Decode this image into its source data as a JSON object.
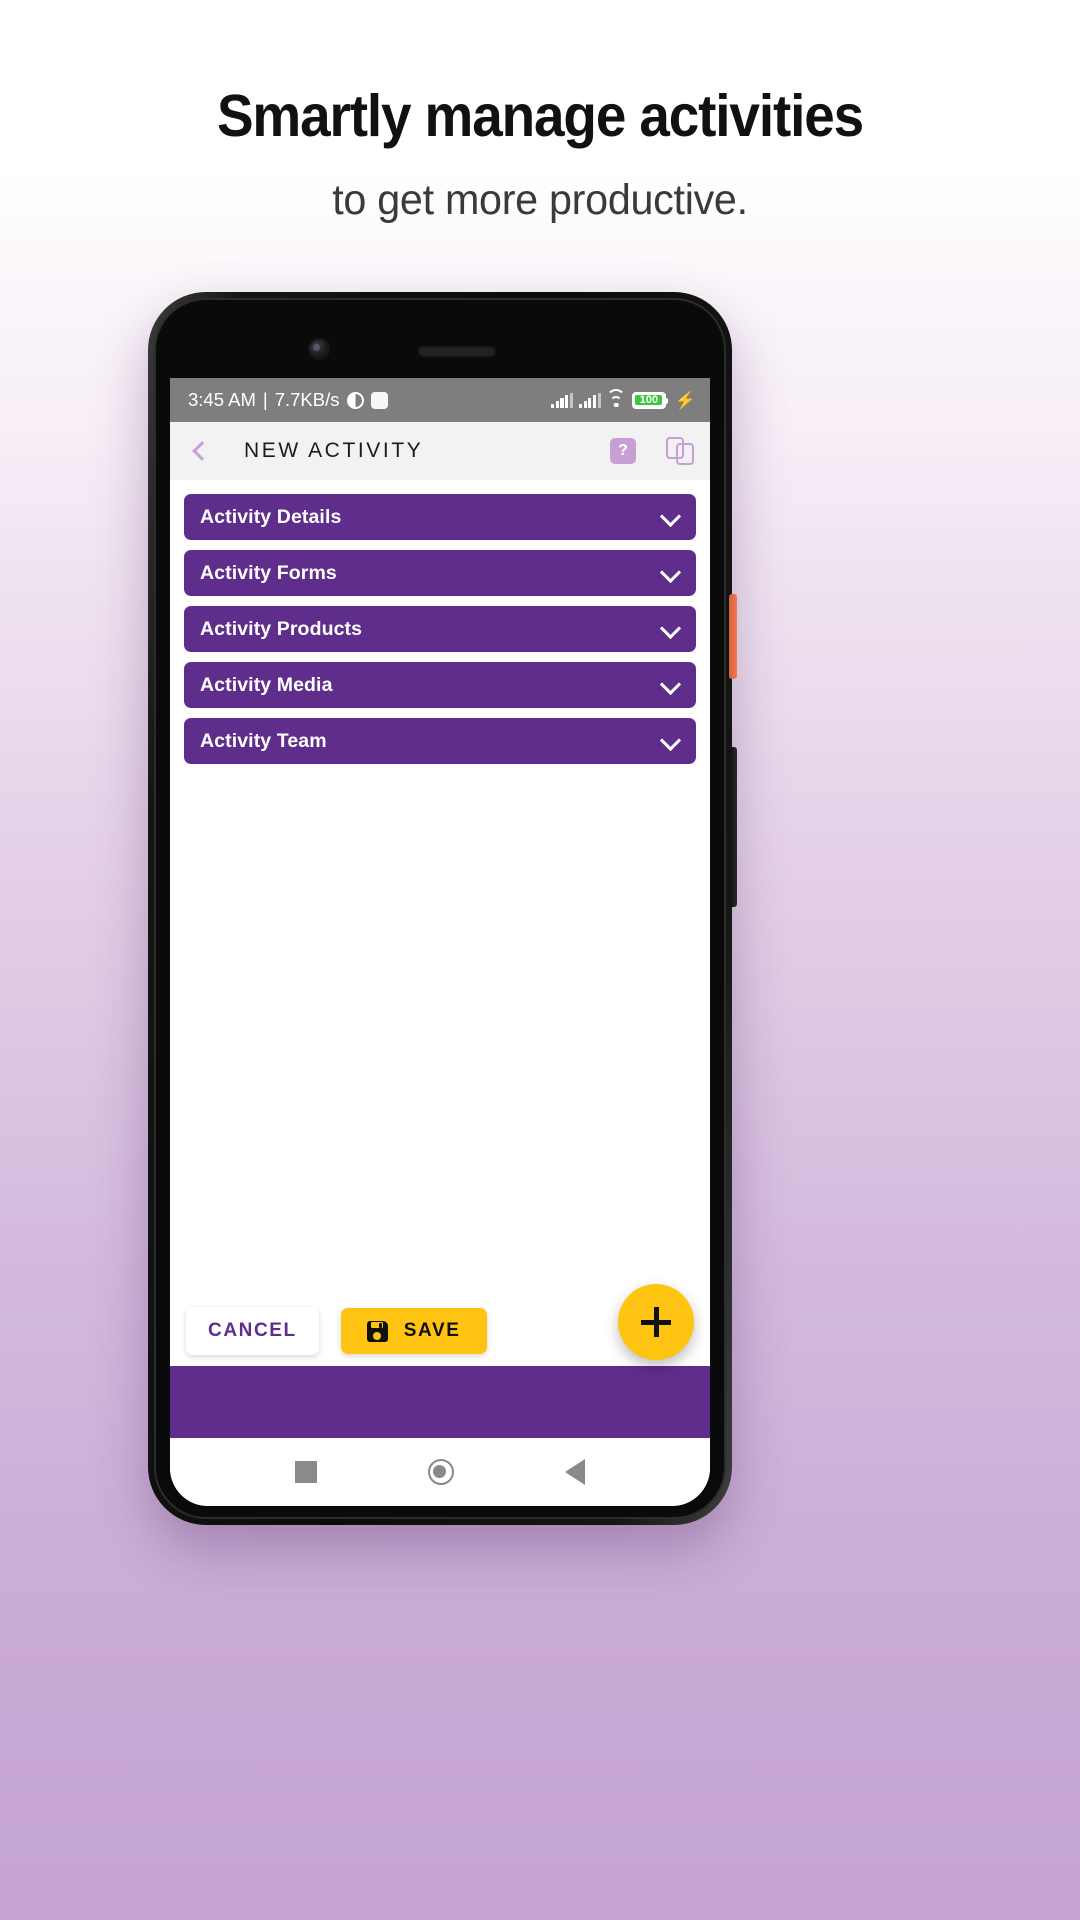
{
  "promo": {
    "headline": "Smartly manage activities",
    "subheadline": "to get more productive."
  },
  "colors": {
    "brand_purple": "#5f2d8c",
    "accent_yellow": "#ffc412",
    "light_purple": "#c79fd4",
    "battery_green": "#3ec63e",
    "power_button_orange": "#e06a43"
  },
  "phone": {
    "statusbar": {
      "time": "3:45 AM",
      "separator": "|",
      "network_speed": "7.7KB/s",
      "icons_left": [
        "contrast-icon",
        "screen-record-icon"
      ],
      "icons_right": [
        "signal-bars-sim1-icon",
        "signal-bars-sim2-icon",
        "wifi-icon",
        "battery-icon",
        "charging-bolt-icon"
      ],
      "battery_percent": "100",
      "charging_bolt": "⚡"
    },
    "appbar": {
      "back_icon": "chevron-left-icon",
      "title": "NEW ACTIVITY",
      "help_label": "?",
      "copy_icon": "copy-icon"
    },
    "accordion": {
      "items": [
        {
          "label": "Activity Details",
          "chevron": "chevron-down-icon"
        },
        {
          "label": "Activity Forms",
          "chevron": "chevron-down-icon"
        },
        {
          "label": "Activity Products",
          "chevron": "chevron-down-icon"
        },
        {
          "label": "Activity Media",
          "chevron": "chevron-down-icon"
        },
        {
          "label": "Activity Team",
          "chevron": "chevron-down-icon"
        }
      ]
    },
    "actions": {
      "cancel_label": "CANCEL",
      "save_label": "SAVE",
      "save_icon": "floppy-disk-save-icon",
      "fab_icon": "plus-icon"
    },
    "navbar": {
      "recents_icon": "square-recents-icon",
      "home_icon": "circle-home-icon",
      "back_icon": "triangle-back-icon"
    }
  }
}
